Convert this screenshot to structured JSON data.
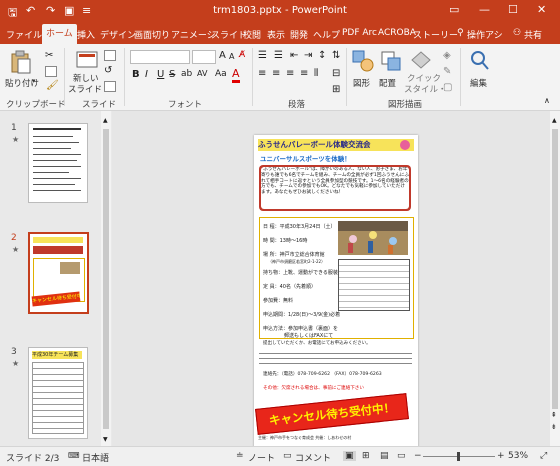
{
  "titlebar": {
    "title": "trm1803.pptx - PowerPoint",
    "qa_save": "🖫",
    "qa_undo": "↶",
    "qa_redo": "↷",
    "qa_present": "▣",
    "qa_more": "≡",
    "min": "—",
    "restore": "☐",
    "close": "✕",
    "ribbon_options": "▭"
  },
  "tabs": [
    {
      "label": "ファイル"
    },
    {
      "label": "ホーム"
    },
    {
      "label": "挿入"
    },
    {
      "label": "デザイン"
    },
    {
      "label": "画面切り"
    },
    {
      "label": "アニメーシ"
    },
    {
      "label": "スライド"
    },
    {
      "label": "校閲"
    },
    {
      "label": "表示"
    },
    {
      "label": "開発"
    },
    {
      "label": "ヘルプ"
    },
    {
      "label": "PDF Arc"
    },
    {
      "label": "ACROBA"
    },
    {
      "label": "ストーリー"
    }
  ],
  "search_label": "操作アシ",
  "share_label": "共有",
  "ribbon": {
    "clipboard": {
      "paste": "貼り付け",
      "group": "クリップボード"
    },
    "slides": {
      "new_slide_1": "新しい",
      "new_slide_2": "スライド・",
      "group": "スライド"
    },
    "font": {
      "group": "フォント",
      "bold": "B",
      "italic": "I",
      "underline": "U",
      "strike": "S",
      "shadow": "ab",
      "spacing": "AV",
      "case": "Aa",
      "color": "A",
      "grow": "A",
      "shrink": "A"
    },
    "paragraph": {
      "group": "段落"
    },
    "drawing": {
      "shapes": "図形",
      "arrange": "配置",
      "quick_styles_1": "クイック",
      "quick_styles_2": "スタイル・",
      "group": "図形描画"
    },
    "editing": {
      "label": "編集"
    }
  },
  "thumbnails": [
    {
      "number": "1",
      "star": "★"
    },
    {
      "number": "2",
      "star": "★",
      "banner": "キャンセル待ち受付中"
    },
    {
      "number": "3",
      "star": "★",
      "title": "平成30年チーム募集"
    }
  ],
  "slide": {
    "title": "ふうせんバレーボール体験交流会",
    "subtitle": "ユニバーサルスポーツを体験！",
    "intro": "\"ふうせんバレーボール\"は、障がいのある人、ない人、お子さま、お年寄りも誰でも6名でチームを組み、チームの全員が必ず1回ふうせんにふれて相手コートに返すという全員参加型の競技です。1～6名の経験者の方でも、チームでの参加でもOK。どなたでも気軽に参加していただけます。あなたもぜひお試しくださいね！",
    "date": "日 程：平成30年3月24日（土）",
    "time": "時 間：13時～16時",
    "place": "場 所：神戸市立総合体育館",
    "place_sub": "（神戸市須磨区若宮町2-1-22）",
    "items": "持ち物：上靴、運動ができる服装",
    "capacity": "定 員：40名（先着順）",
    "fee": "参加費：無料",
    "period": "申込期間：1/28(日)～3/9(金)必着",
    "method": "申込方法：参加申込書（裏面）を",
    "method2": "郵送もしくはFAXにて",
    "method3": "提出していただくか、お電話にてお申込みください。",
    "contact": "連絡先：（電話）078-709-6262 （FAX）078-709-6263",
    "note": "その他：欠席される場合は、事前にご連絡下さい",
    "banner": "キャンセル待ち受付中！",
    "footer": "主催：神戸市手をつなぐ育成会 共催：しあわせの村"
  },
  "status": {
    "slide": "スライド 2/3",
    "lang": "日本語",
    "notes": "ノート",
    "comments": "コメント",
    "zoom_minus": "−",
    "zoom_plus": "+",
    "zoom": "53%",
    "fit": "⤢"
  }
}
